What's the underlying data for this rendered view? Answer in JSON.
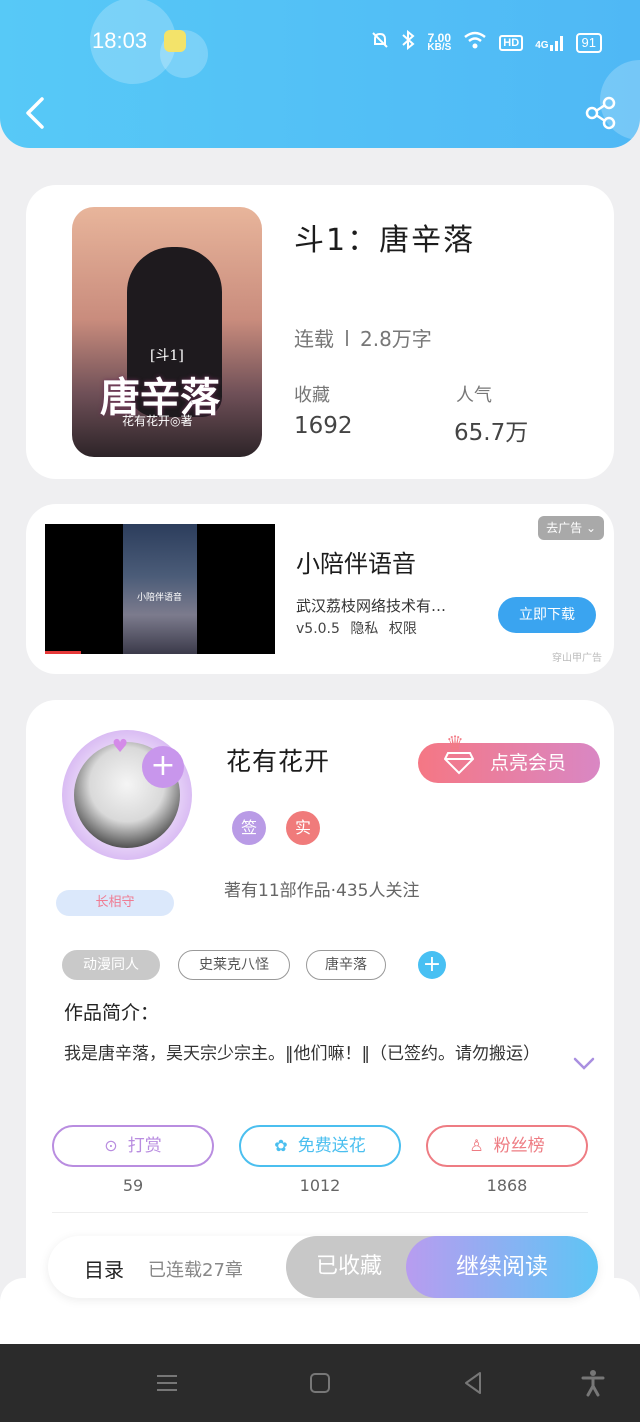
{
  "status_bar": {
    "time": "18:03",
    "net_speed_value": "7.00",
    "net_speed_unit": "KB/S",
    "hd": "HD",
    "signal": "4G",
    "battery": "91"
  },
  "header": {
    "back_icon": "back-icon",
    "share_icon": "share-icon"
  },
  "book": {
    "cover": {
      "subtitle": "[斗1]",
      "title": "唐辛落",
      "author": "花有花开◎著"
    },
    "title": "斗1：唐辛落",
    "status": "连载",
    "word_count": "2.8万字",
    "favorites_label": "收藏",
    "favorites_value": "1692",
    "popularity_label": "人气",
    "popularity_value": "65.7万"
  },
  "ad": {
    "video_caption": "小陪伴语音",
    "app_name": "小陪伴语音",
    "company": "武汉荔枝网络技术有…",
    "version": "v5.0.5",
    "privacy": "隐私",
    "permission": "权限",
    "remove_label": "去广告",
    "download_label": "立即下载",
    "source": "穿山甲广告"
  },
  "author": {
    "name": "花有花开",
    "badge": "长相守",
    "vip_label": "点亮会员",
    "tag_signed": "签",
    "tag_real": "实",
    "stats": "著有11部作品·435人关注",
    "chips": [
      "动漫同人",
      "史莱克八怪",
      "唐辛落"
    ],
    "intro_label": "作品简介：",
    "intro_text": "我是唐辛落，昊天宗少宗主。‖他们嘛！‖（已签约。请勿搬运）",
    "actions": [
      {
        "label": "打赏",
        "count": "59",
        "icon": "yen-icon",
        "color": "#b98de0"
      },
      {
        "label": "免费送花",
        "count": "1012",
        "icon": "flower-icon",
        "color": "#4bbfef"
      },
      {
        "label": "粉丝榜",
        "count": "1868",
        "icon": "fans-icon",
        "color": "#ee7c83"
      }
    ]
  },
  "read_bar": {
    "toc_label": "目录",
    "chapters": "已连载27章",
    "collected_label": "已收藏",
    "continue_label": "继续阅读"
  },
  "colors": {
    "header": "#57c9f7",
    "vip": "#f57784",
    "continue_start": "#b89cf0",
    "continue_end": "#5ec5f5"
  }
}
